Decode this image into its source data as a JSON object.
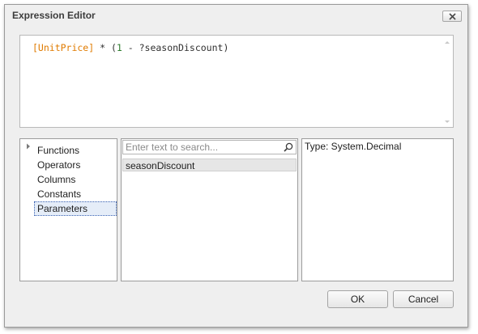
{
  "window": {
    "title": "Expression Editor"
  },
  "editor": {
    "tokens": {
      "field": "[UnitPrice]",
      "op_mult": " * (",
      "number": "1",
      "op_minus": " - ",
      "param": "?seasonDiscount",
      "close": ")"
    }
  },
  "categories": {
    "items": [
      {
        "label": "Functions",
        "expandable": true
      },
      {
        "label": "Operators"
      },
      {
        "label": "Columns"
      },
      {
        "label": "Constants"
      },
      {
        "label": "Parameters",
        "selected": true
      }
    ]
  },
  "search": {
    "placeholder": "Enter text to search...",
    "icon": "search-icon"
  },
  "items_list": {
    "items": [
      "seasonDiscount"
    ]
  },
  "description": {
    "text": "Type: System.Decimal"
  },
  "buttons": {
    "ok": "OK",
    "cancel": "Cancel"
  },
  "colors": {
    "field_token": "#e07b00",
    "number_token": "#2e7d2e",
    "selection_border": "#3c64b4"
  }
}
